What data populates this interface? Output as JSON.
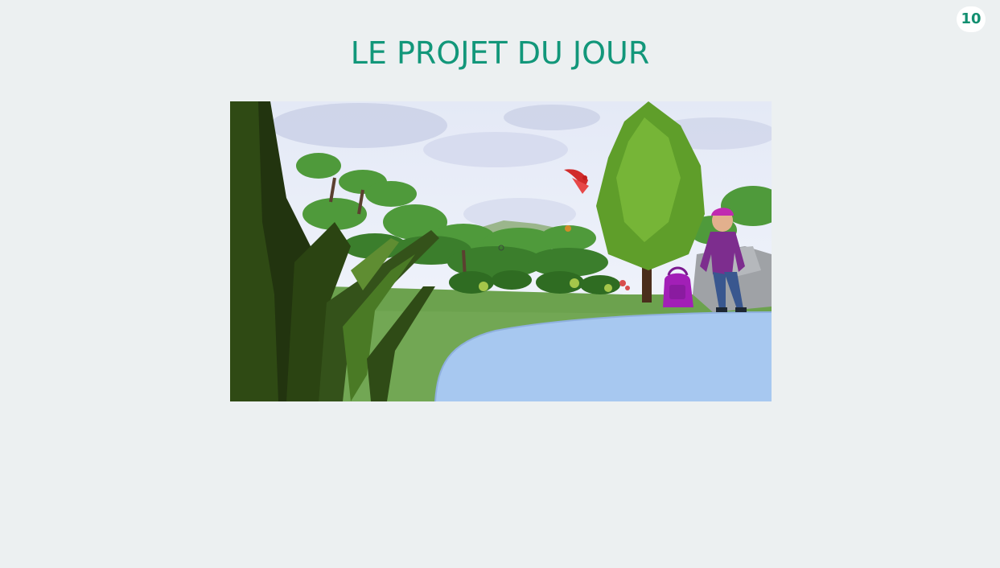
{
  "slide": {
    "page_number": "10",
    "title": "LE PROJET DU JOUR"
  },
  "colors": {
    "background": "#ecf0f1",
    "title": "#12977a",
    "badge_text": "#128f70",
    "badge_bg": "#ffffff"
  },
  "scene": {
    "description_icons": [
      "forest-scene",
      "lake",
      "parrot-icon",
      "character",
      "backpack-icon"
    ]
  }
}
